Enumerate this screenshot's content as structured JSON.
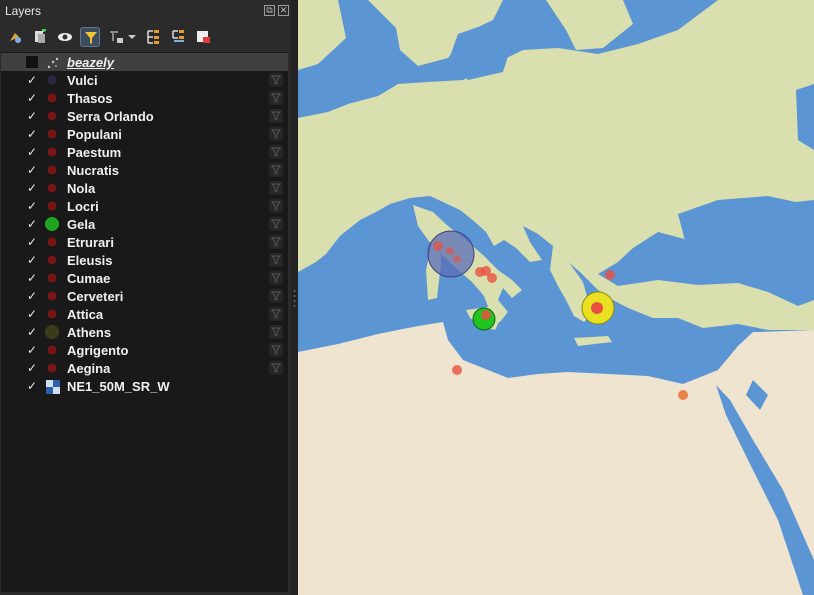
{
  "panel": {
    "title": "Layers"
  },
  "toolbar": [
    {
      "name": "open-layer-styling-icon"
    },
    {
      "name": "add-group-icon"
    },
    {
      "name": "manage-visibility-icon"
    },
    {
      "name": "filter-legend-icon",
      "active": true
    },
    {
      "name": "filter-expression-icon"
    },
    {
      "name": "expand-all-icon"
    },
    {
      "name": "collapse-all-icon"
    },
    {
      "name": "remove-layer-icon"
    }
  ],
  "layers": [
    {
      "id": "beazely",
      "label": "beazely",
      "kind": "group",
      "checked": false,
      "symbol": "points-icon",
      "selected": true
    },
    {
      "id": "vulci",
      "label": "Vulci",
      "kind": "point",
      "checked": true,
      "color": "#2a2a44"
    },
    {
      "id": "thasos",
      "label": "Thasos",
      "kind": "point",
      "checked": true,
      "color": "#7a1515"
    },
    {
      "id": "serra-orlando",
      "label": "Serra Orlando",
      "kind": "point",
      "checked": true,
      "color": "#7a1515"
    },
    {
      "id": "populani",
      "label": "Populani",
      "kind": "point",
      "checked": true,
      "color": "#7a1515"
    },
    {
      "id": "paestum",
      "label": "Paestum",
      "kind": "point",
      "checked": true,
      "color": "#7a1515"
    },
    {
      "id": "nucratis",
      "label": "Nucratis",
      "kind": "point",
      "checked": true,
      "color": "#7a1515"
    },
    {
      "id": "nola",
      "label": "Nola",
      "kind": "point",
      "checked": true,
      "color": "#7a1515"
    },
    {
      "id": "locri",
      "label": "Locri",
      "kind": "point",
      "checked": true,
      "color": "#7a1515"
    },
    {
      "id": "gela",
      "label": "Gela",
      "kind": "point",
      "checked": true,
      "color": "#21a421",
      "large": true
    },
    {
      "id": "etrurari",
      "label": "Etrurari",
      "kind": "point",
      "checked": true,
      "color": "#7a1515"
    },
    {
      "id": "eleusis",
      "label": "Eleusis",
      "kind": "point",
      "checked": true,
      "color": "#7a1515"
    },
    {
      "id": "cumae",
      "label": "Cumae",
      "kind": "point",
      "checked": true,
      "color": "#7a1515"
    },
    {
      "id": "cerveteri",
      "label": "Cerveteri",
      "kind": "point",
      "checked": true,
      "color": "#7a1515"
    },
    {
      "id": "attica",
      "label": "Attica",
      "kind": "point",
      "checked": true,
      "color": "#7a1515"
    },
    {
      "id": "athens",
      "label": "Athens",
      "kind": "point",
      "checked": true,
      "color": "#3b3b17",
      "large": true
    },
    {
      "id": "agrigento",
      "label": "Agrigento",
      "kind": "point",
      "checked": true,
      "color": "#7a1515"
    },
    {
      "id": "aegina",
      "label": "Aegina",
      "kind": "point",
      "checked": true,
      "color": "#7a1515"
    },
    {
      "id": "ne1-50m-sr-w",
      "label": "NE1_50M_SR_W",
      "kind": "raster",
      "checked": true,
      "symbol": "raster-icon"
    }
  ],
  "map": {
    "colors": {
      "sea": "#5b95d3",
      "land": "#d9dfae",
      "desert": "#efe4d0"
    },
    "symbols": [
      {
        "name": "vulci-map-symbol",
        "color": "#5a6eb8",
        "size": "large"
      },
      {
        "name": "athens-map-symbol",
        "color": "#e8e020",
        "size": "medium"
      },
      {
        "name": "gela-map-symbol",
        "color": "#22c422",
        "size": "small"
      },
      {
        "name": "site-map-symbol",
        "color": "#e85040",
        "size": "point"
      }
    ]
  }
}
